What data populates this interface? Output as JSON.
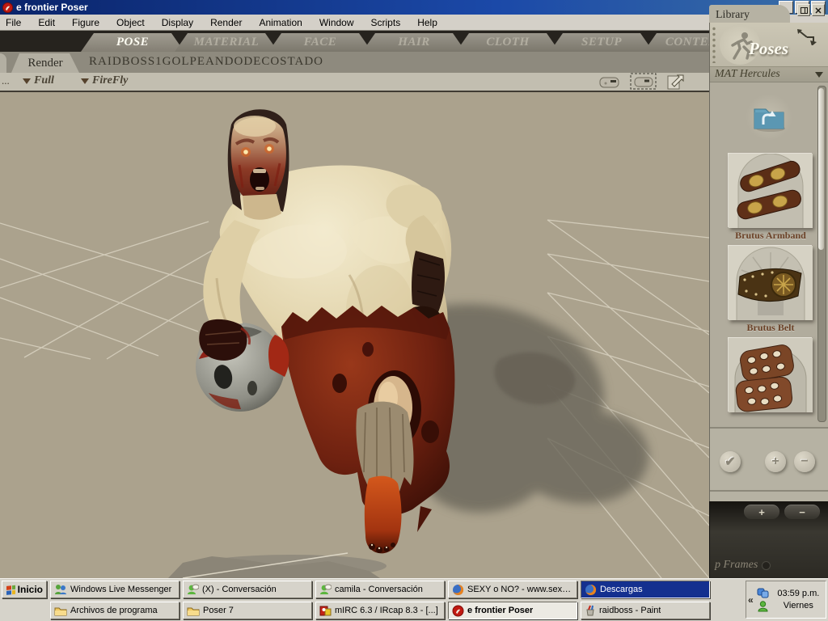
{
  "window": {
    "title": "e frontier Poser"
  },
  "menu": {
    "items": [
      "File",
      "Edit",
      "Figure",
      "Object",
      "Display",
      "Render",
      "Animation",
      "Window",
      "Scripts",
      "Help"
    ]
  },
  "rooms": {
    "active": "POSE",
    "tabs": [
      "POSE",
      "MATERIAL",
      "FACE",
      "HAIR",
      "CLOTH",
      "SETUP",
      "CONTENT"
    ]
  },
  "document": {
    "tab_label": "Render",
    "title": "RAIDBOSS1GOLPEANDODECOSTADO"
  },
  "viewport": {
    "overflow_label": "...",
    "camera": "Full",
    "renderer": "FireFly",
    "scene_description": "Red-faced zombie brute in ragged red loincloth holding a severed gray head, tan backdrop with perspective ground grid and cast shadow"
  },
  "library": {
    "panel_title": "Library",
    "category": "Poses",
    "folder": "MAT Hercules",
    "items": [
      {
        "label": "Brutus Armband"
      },
      {
        "label": "Brutus Belt"
      },
      {
        "label": ""
      }
    ],
    "actions": {
      "apply_glyph": "✔",
      "add_glyph": "+",
      "remove_glyph": "−"
    }
  },
  "animation": {
    "add_frame": "+",
    "remove_frame": "−",
    "frames_label": "p Frames"
  },
  "taskbar": {
    "start": "Inicio",
    "row1": [
      {
        "label": "Windows Live Messenger"
      },
      {
        "label": "(X) - Conversación"
      },
      {
        "label": "camila - Conversación"
      },
      {
        "label": "SEXY o NO? - www.sexy..."
      },
      {
        "label": "Descargas"
      }
    ],
    "row2": [
      {
        "label": "Archivos de programa"
      },
      {
        "label": "Poser 7"
      },
      {
        "label": "mIRC 6.3 / IRcap 8.3 - [...]"
      },
      {
        "label": "e frontier Poser"
      },
      {
        "label": "raidboss - Paint"
      }
    ],
    "tray": {
      "chevron": "«",
      "time": "03:59 p.m.",
      "day": "Viernes"
    }
  },
  "colors": {
    "titlebar_blue": "#0a246a",
    "viewport_tan": "#aba28d",
    "active_task_blue": "#14308f",
    "loincloth_red": "#6e2110",
    "library_bg": "#b6b2a3"
  }
}
